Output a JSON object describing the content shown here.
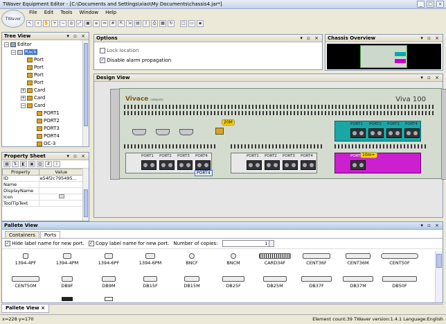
{
  "window": {
    "title": "TWaver Equipment Editor - [C:\\Documents and Settings\\xiao\\My Documents\\chassis4.jar*]",
    "min": "_",
    "max": "□",
    "close": "×"
  },
  "logo": {
    "text": "TWaver"
  },
  "menu": [
    "File",
    "Edit",
    "Tools",
    "Window",
    "Help"
  ],
  "tree": {
    "title": "Tree View",
    "controls": "▾ ▫ ×",
    "nodes": [
      {
        "label": "Editor",
        "level": 0,
        "icon": "editor-icon",
        "expander": "−"
      },
      {
        "label": "Rack",
        "level": 1,
        "icon": "rack-icon",
        "expander": "−",
        "selected": true
      },
      {
        "label": "Port",
        "level": 2,
        "icon": "port-icon"
      },
      {
        "label": "Port",
        "level": 2,
        "icon": "port-icon"
      },
      {
        "label": "Port",
        "level": 2,
        "icon": "port-icon"
      },
      {
        "label": "Port",
        "level": 2,
        "icon": "port-icon"
      },
      {
        "label": "Card",
        "level": 2,
        "icon": "card-icon",
        "expander": "+"
      },
      {
        "label": "Card",
        "level": 2,
        "icon": "card-icon",
        "expander": "+"
      },
      {
        "label": "Card",
        "level": 2,
        "icon": "card-icon",
        "expander": "−"
      },
      {
        "label": "PORT1",
        "level": 3,
        "icon": "port-icon"
      },
      {
        "label": "PORT2",
        "level": 3,
        "icon": "port-icon"
      },
      {
        "label": "PORT3",
        "level": 3,
        "icon": "port-icon"
      },
      {
        "label": "PORT4",
        "level": 3,
        "icon": "port-icon"
      },
      {
        "label": "OC-3",
        "level": 3,
        "icon": "port-icon"
      }
    ]
  },
  "property_sheet": {
    "title": "Property Sheet",
    "controls": "▾ ▫ ×",
    "columns": [
      "Property",
      "Value"
    ],
    "rows": [
      [
        "ID",
        "e54f2c795495..."
      ],
      [
        "Name",
        ""
      ],
      [
        "DisplayName",
        ""
      ],
      [
        "Icon",
        ""
      ],
      [
        "ToolTipText",
        ""
      ]
    ]
  },
  "options": {
    "title": "Options",
    "controls": "▾ ▫ ×",
    "lock_location": {
      "label": "Lock location",
      "checked": false
    },
    "disable_alarm": {
      "label": "Disable alarm propagation",
      "checked": true
    }
  },
  "overview": {
    "title": "Chassis Overview",
    "controls": "▾ ▫ ×"
  },
  "design": {
    "title": "Design View",
    "controls": "▾ ▫ ×",
    "brand": "Vivace",
    "brand_sub": "networks",
    "model": "Viva 100",
    "tag_20m": "20M",
    "tag_10m": "10m+",
    "tooltip": "PORT4",
    "card_a_ports": [
      "PORT1",
      "PORT2",
      "PORT3",
      "PORT4"
    ],
    "card_b_ports": [
      "PORT1",
      "PORT2",
      "PORT3",
      "PORT4"
    ],
    "card_c_ports": [
      "PORT1",
      "PORT2",
      "PORT3",
      "PORT4"
    ],
    "card_d_ports": [
      "PORT1"
    ]
  },
  "pallete": {
    "title": "Pallete View",
    "controls": "▾ ▫ ×",
    "tabs": [
      "Containers",
      "Ports"
    ],
    "hide_label": {
      "label": "Hide label name for new port.",
      "checked": true
    },
    "copy_label": {
      "label": "Copy label name for new port.",
      "checked": true
    },
    "copies_label": "Number of copies:",
    "copies_value": "1",
    "row1": [
      "1394-4PF",
      "1394-4PM",
      "1394-6PF",
      "1394-6PM",
      "BNCF",
      "BNCM",
      "CARD34F",
      "CENT36F",
      "CENT36M",
      "CENT50F"
    ],
    "row2": [
      "CENT50M",
      "DB9F",
      "DB9M",
      "DB15F",
      "DB15M",
      "DB25F",
      "DB25M",
      "DB37F",
      "DB37M",
      "DB50F"
    ]
  },
  "bottom_tab": {
    "label": "Pallete View",
    "controls": "×"
  },
  "status": {
    "coords": "x=228 y=170",
    "info": "Element count:39 TWaver version:1.4.1 Language:English"
  }
}
